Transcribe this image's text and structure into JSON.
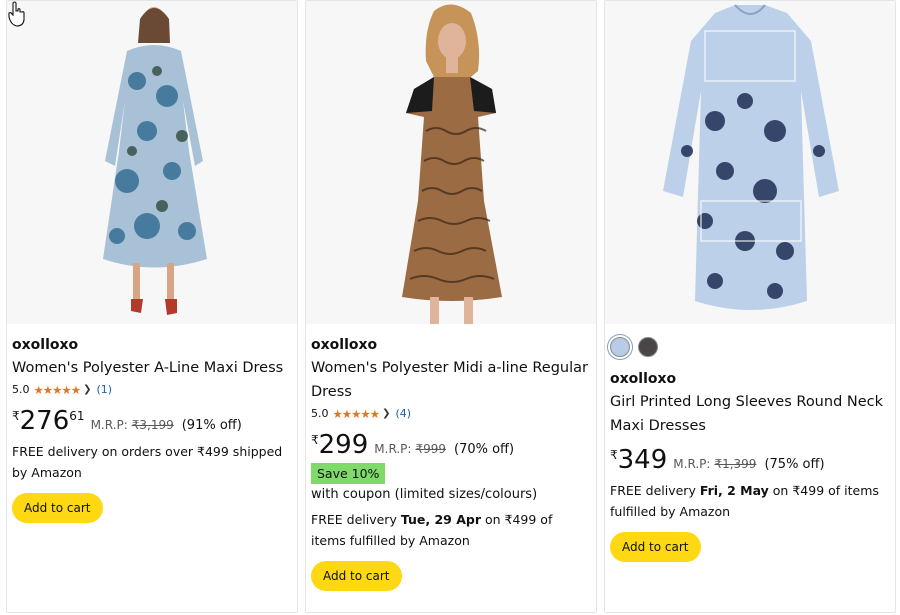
{
  "products": [
    {
      "brand": "oxolloxo",
      "title": "Women's Polyester A-Line Maxi Dress",
      "rating": "5.0",
      "stars": "★★★★★",
      "rating_count": "(1)",
      "currency": "₹",
      "price_whole": "276",
      "price_fraction": "61",
      "mrp_label": "M.R.P:",
      "mrp": "₹3,199",
      "discount": "(91% off)",
      "delivery": "FREE delivery on orders over ₹499 shipped by Amazon",
      "add_to_cart": "Add to cart"
    },
    {
      "brand": "oxolloxo",
      "title": "Women's Polyester Midi a-line Regular Dress",
      "rating": "5.0",
      "stars": "★★★★★",
      "rating_count": "(4)",
      "currency": "₹",
      "price_whole": "299",
      "mrp_label": "M.R.P:",
      "mrp": "₹999",
      "discount": "(70% off)",
      "save_badge": "Save 10%",
      "coupon_text": "with coupon (limited sizes/colours)",
      "delivery_prefix": "FREE delivery ",
      "delivery_date": "Tue, 29 Apr",
      "delivery_suffix": " on ₹499 of items fulfilled by Amazon",
      "add_to_cart": "Add to cart"
    },
    {
      "swatches": [
        {
          "name": "light-blue",
          "color": "#b9cbe6"
        },
        {
          "name": "dark-grey",
          "color": "#4a4648"
        }
      ],
      "brand": "oxolloxo",
      "title": "Girl Printed Long Sleeves Round Neck Maxi Dresses",
      "currency": "₹",
      "price_whole": "349",
      "mrp_label": "M.R.P:",
      "mrp": "₹1,399",
      "discount": "(75% off)",
      "delivery_prefix": "FREE delivery ",
      "delivery_date": "Fri, 2 May",
      "delivery_suffix": " on ₹499 of items fulfilled by Amazon",
      "add_to_cart": "Add to cart"
    }
  ],
  "colors": {
    "add_to_cart_bg": "#ffd814",
    "star": "#de7921",
    "link": "#2162a1",
    "save_badge": "#7fda69"
  },
  "icons": [
    "hand-pointer-cursor",
    "chevron-down-icon",
    "star-icon"
  ]
}
